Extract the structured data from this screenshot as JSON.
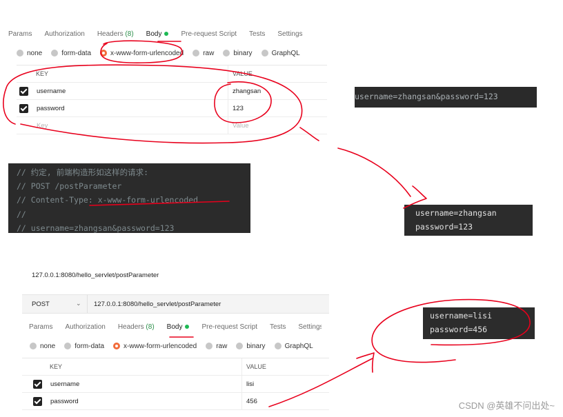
{
  "panel_top": {
    "tabs": [
      {
        "label": "Params"
      },
      {
        "label": "Authorization"
      },
      {
        "label": "Headers",
        "count": "(8)"
      },
      {
        "label": "Body",
        "active": true
      },
      {
        "label": "Pre-request Script"
      },
      {
        "label": "Tests"
      },
      {
        "label": "Settings"
      }
    ],
    "body_types": [
      "none",
      "form-data",
      "x-www-form-urlencoded",
      "raw",
      "binary",
      "GraphQL"
    ],
    "selected_body_type": "x-www-form-urlencoded",
    "table": {
      "key_header": "KEY",
      "value_header": "VALUE",
      "rows": [
        {
          "key": "username",
          "value": "zhangsan",
          "checked": true
        },
        {
          "key": "password",
          "value": "123",
          "checked": true
        }
      ],
      "placeholder_key": "Key",
      "placeholder_value": "Value"
    }
  },
  "panel_bottom": {
    "title": "127.0.0.1:8080/hello_servlet/postParameter",
    "method": "POST",
    "url": "127.0.0.1:8080/hello_servlet/postParameter",
    "tabs": [
      {
        "label": "Params"
      },
      {
        "label": "Authorization"
      },
      {
        "label": "Headers",
        "count": "(8)"
      },
      {
        "label": "Body",
        "active": true
      },
      {
        "label": "Pre-request Script"
      },
      {
        "label": "Tests"
      },
      {
        "label": "Settings"
      }
    ],
    "body_types": [
      "none",
      "form-data",
      "x-www-form-urlencoded",
      "raw",
      "binary",
      "GraphQL"
    ],
    "selected_body_type": "x-www-form-urlencoded",
    "table": {
      "key_header": "KEY",
      "value_header": "VALUE",
      "rows": [
        {
          "key": "username",
          "value": "lisi",
          "checked": true
        },
        {
          "key": "password",
          "value": "456",
          "checked": true
        }
      ]
    }
  },
  "terminal_1": {
    "line": "username=zhangsan&password=123"
  },
  "code_comment": {
    "lines": [
      "// 约定, 前端构造形如这样的请求:",
      "// POST /postParameter",
      "// Content-Type: x-www-form-urlencoded",
      "//",
      "// username=zhangsan&password=123"
    ]
  },
  "terminal_2": {
    "lines": [
      "username=zhangsan",
      "password=123"
    ]
  },
  "terminal_3": {
    "lines": [
      "username=lisi",
      "password=456"
    ]
  },
  "watermark": "CSDN @英雄不问出处~",
  "colors": {
    "accent": "#f26b3a",
    "active_dot": "#1db954",
    "annotation": "#e8001c"
  }
}
